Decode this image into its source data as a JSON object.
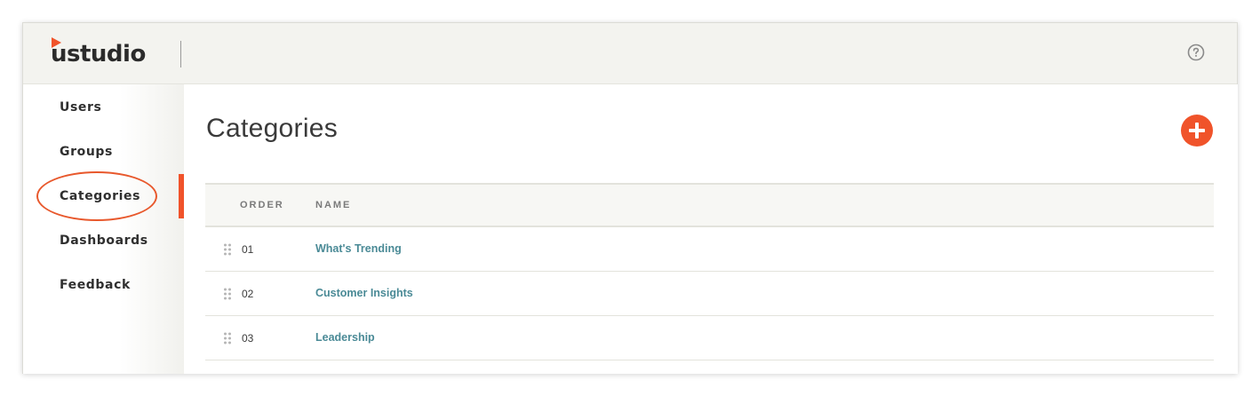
{
  "app": {
    "logo_text": "ustudio",
    "help_icon": "question-circle-icon",
    "accent_color": "#f0532a",
    "link_color": "#4a8a96"
  },
  "sidebar": {
    "items": [
      {
        "label": "Users",
        "active": false
      },
      {
        "label": "Groups",
        "active": false
      },
      {
        "label": "Categories",
        "active": true
      },
      {
        "label": "Dashboards",
        "active": false
      },
      {
        "label": "Feedback",
        "active": false
      }
    ]
  },
  "main": {
    "title": "Categories",
    "add_icon": "plus-icon",
    "table": {
      "columns": [
        "ORDER",
        "NAME"
      ],
      "rows": [
        {
          "order": "01",
          "name": "What's Trending"
        },
        {
          "order": "02",
          "name": "Customer Insights"
        },
        {
          "order": "03",
          "name": "Leadership"
        }
      ]
    }
  }
}
